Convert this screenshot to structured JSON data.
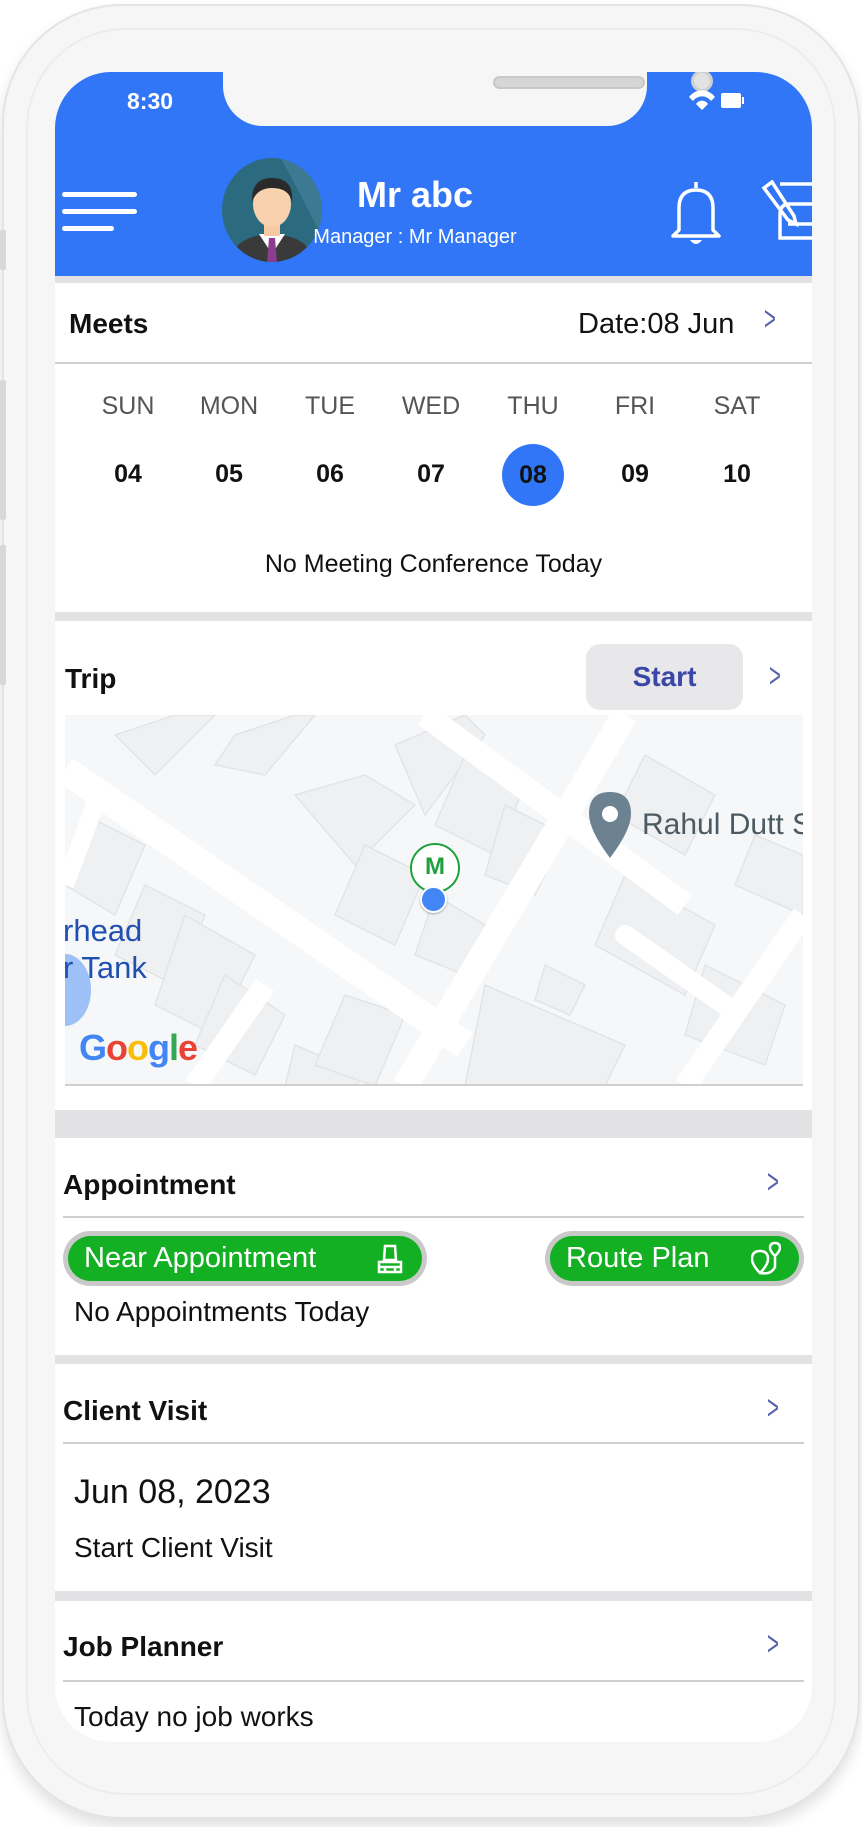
{
  "status_bar": {
    "time": "8:30",
    "icons": [
      "wifi-icon",
      "battery-icon"
    ]
  },
  "header": {
    "name": "Mr abc",
    "subtitle": "Manager : Mr Manager",
    "icons": [
      "menu-icon",
      "avatar",
      "bell-icon",
      "edit-note-icon"
    ],
    "color": "#3076f6"
  },
  "meets": {
    "title": "Meets",
    "date": "Date:08 Jun",
    "days": [
      {
        "label": "SUN",
        "num": "04"
      },
      {
        "label": "MON",
        "num": "05"
      },
      {
        "label": "TUE",
        "num": "06"
      },
      {
        "label": "WED",
        "num": "07"
      },
      {
        "label": "THU",
        "num": "08",
        "selected": true
      },
      {
        "label": "FRI",
        "num": "09"
      },
      {
        "label": "SAT",
        "num": "10"
      }
    ],
    "empty": "No Meeting Conference Today"
  },
  "trip": {
    "title": "Trip",
    "start": "Start",
    "map": {
      "place": "Rahul Dutt S",
      "area_line1": "rhead",
      "area_line2": "r Tank",
      "marker": "M",
      "logo": "Google"
    }
  },
  "appointment": {
    "title": "Appointment",
    "near": "Near Appointment",
    "route": "Route Plan",
    "empty": "No Appointments Today",
    "button_color": "#14b023"
  },
  "client_visit": {
    "title": "Client Visit",
    "date": "Jun 08, 2023",
    "action": "Start Client Visit"
  },
  "job_planner": {
    "title": "Job Planner",
    "empty": "Today no job works"
  }
}
